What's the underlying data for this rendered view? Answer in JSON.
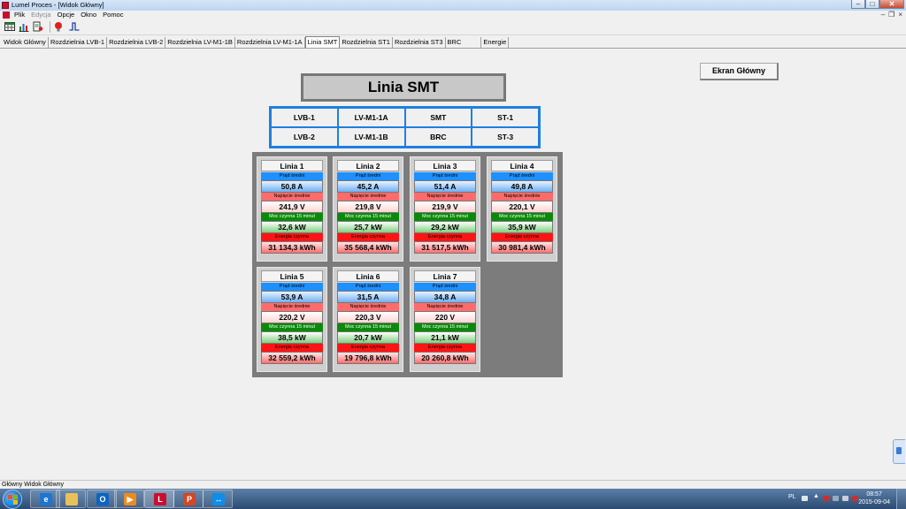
{
  "window": {
    "title": "Lumel Proces - [Widok Główny]"
  },
  "menu": {
    "items": [
      "Plik",
      "Edycja",
      "Opcje",
      "Okno",
      "Pomoc"
    ]
  },
  "tabs": {
    "items": [
      "Widok Główny",
      "Rozdzielnia LVB-1",
      "Rozdzielnia LVB-2",
      "Rozdzielnia LV-M1-1B",
      "Rozdzielnia LV-M1-1A",
      "Linia SMT",
      "Rozdzielnia ST1",
      "Rozdzielnia ST3",
      "BRC",
      "Energie"
    ],
    "active": "Linia SMT"
  },
  "main": {
    "home_button": "Ekran Główny",
    "title": "Linia SMT",
    "nav": [
      "LVB-1",
      "LV-M1-1A",
      "SMT",
      "ST-1",
      "LVB-2",
      "LV-M1-1B",
      "BRC",
      "ST-3"
    ],
    "labels": {
      "current": "Prąd średni",
      "voltage": "Napięcie średnie",
      "power": "Moc czynna 15 minut",
      "energy": "Energia czynna"
    },
    "lines": [
      {
        "name": "Linia 1",
        "current": "50,8 A",
        "voltage": "241,9 V",
        "power": "32,6 kW",
        "energy": "31 134,3 kWh"
      },
      {
        "name": "Linia 2",
        "current": "45,2 A",
        "voltage": "219,8 V",
        "power": "25,7 kW",
        "energy": "35 568,4 kWh"
      },
      {
        "name": "Linia 3",
        "current": "51,4 A",
        "voltage": "219,9 V",
        "power": "29,2 kW",
        "energy": "31 517,5 kWh"
      },
      {
        "name": "Linia 4",
        "current": "49,8 A",
        "voltage": "220,1 V",
        "power": "35,9 kW",
        "energy": "30 981,4 kWh"
      },
      {
        "name": "Linia 5",
        "current": "53,9 A",
        "voltage": "220,2 V",
        "power": "38,5 kW",
        "energy": "32 559,2 kWh"
      },
      {
        "name": "Linia 6",
        "current": "31,5 A",
        "voltage": "220,3 V",
        "power": "20,7 kW",
        "energy": "19 796,8 kWh"
      },
      {
        "name": "Linia 7",
        "current": "34,8 A",
        "voltage": "220 V",
        "power": "21,1 kW",
        "energy": "20 260,8 kWh"
      }
    ]
  },
  "status": {
    "text": "Główny Widok Główny"
  },
  "taskbar": {
    "lang": "PL",
    "time": "08:57",
    "date": "2015-09-04"
  }
}
